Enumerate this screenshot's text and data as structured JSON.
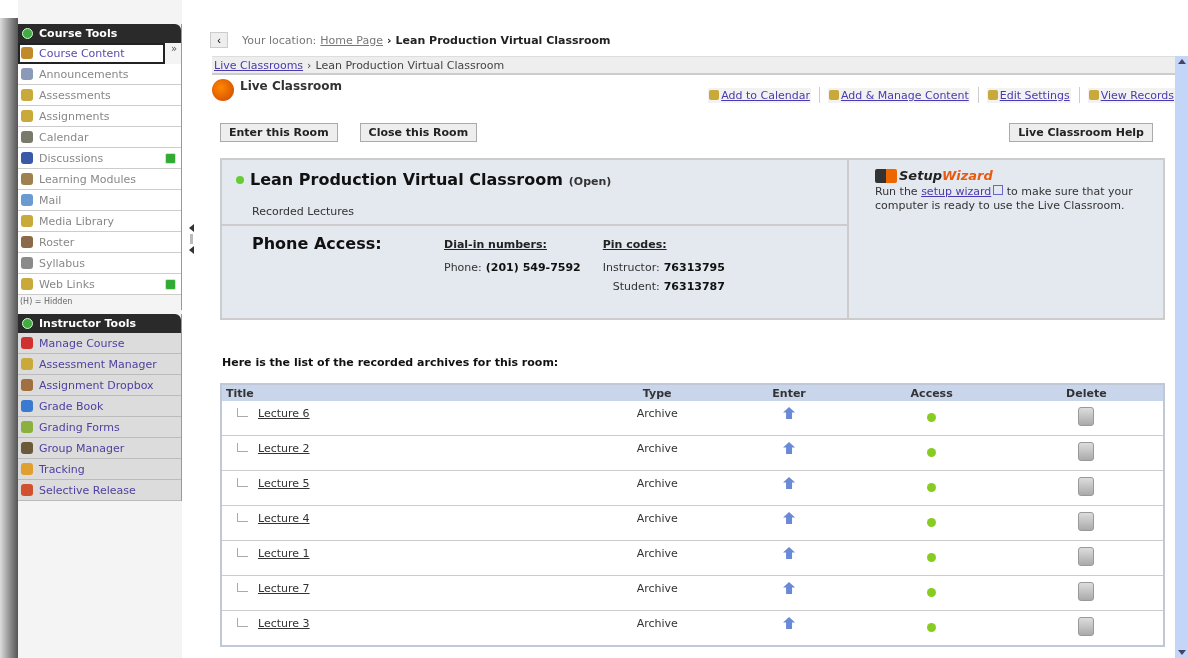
{
  "sidebar": {
    "course_tools": {
      "title": "Course Tools",
      "items": [
        {
          "label": "Course Content",
          "selected": true,
          "badge": false,
          "color": "#c08a2a"
        },
        {
          "label": "Announcements",
          "selected": false,
          "badge": false,
          "color": "#8a9ab8"
        },
        {
          "label": "Assessments",
          "selected": false,
          "badge": false,
          "color": "#c9a93a"
        },
        {
          "label": "Assignments",
          "selected": false,
          "badge": false,
          "color": "#c9a93a"
        },
        {
          "label": "Calendar",
          "selected": false,
          "badge": false,
          "color": "#7a7a6a"
        },
        {
          "label": "Discussions",
          "selected": false,
          "badge": true,
          "color": "#3a5aa8"
        },
        {
          "label": "Learning Modules",
          "selected": false,
          "badge": false,
          "color": "#a08050"
        },
        {
          "label": "Mail",
          "selected": false,
          "badge": false,
          "color": "#6a9ad0"
        },
        {
          "label": "Media Library",
          "selected": false,
          "badge": false,
          "color": "#c9a93a"
        },
        {
          "label": "Roster",
          "selected": false,
          "badge": false,
          "color": "#8a6a4a"
        },
        {
          "label": "Syllabus",
          "selected": false,
          "badge": false,
          "color": "#8a8a8a"
        },
        {
          "label": "Web Links",
          "selected": false,
          "badge": true,
          "color": "#c9a93a"
        }
      ],
      "collapse": "»",
      "legend": "(H) = Hidden"
    },
    "instructor_tools": {
      "title": "Instructor Tools",
      "items": [
        {
          "label": "Manage Course",
          "color": "#d03030"
        },
        {
          "label": "Assessment Manager",
          "color": "#c9a93a"
        },
        {
          "label": "Assignment Dropbox",
          "color": "#a07040"
        },
        {
          "label": "Grade Book",
          "color": "#3a7ad0"
        },
        {
          "label": "Grading Forms",
          "color": "#8ab040"
        },
        {
          "label": "Group Manager",
          "color": "#6a5a3a"
        },
        {
          "label": "Tracking",
          "color": "#e0a030"
        },
        {
          "label": "Selective Release",
          "color": "#d05030"
        }
      ]
    }
  },
  "location": {
    "back": "‹",
    "prefix": "Your location:",
    "home": "Home Page",
    "separator": "›",
    "current": "Lean Production Virtual Classroom"
  },
  "breadcrumb": {
    "link": "Live Classrooms",
    "separator": "›",
    "current": "Lean Production Virtual Classroom"
  },
  "header": {
    "title": "Live Classroom",
    "actions": [
      "Add to Calendar",
      "Add & Manage Content",
      "Edit Settings",
      "View Records"
    ]
  },
  "buttons": [
    "Enter this Room",
    "Close this Room"
  ],
  "help_button": "Live Classroom Help",
  "room": {
    "name": "Lean Production Virtual Classroom",
    "status": "(Open)",
    "subtitle": "Recorded Lectures",
    "phone_title": "Phone Access:",
    "dial_heading": "Dial-in numbers:",
    "pin_heading": "Pin codes:",
    "phone_label": "Phone:",
    "phone": "(201) 549-7592",
    "pins": [
      {
        "label": "Instructor:",
        "value": "76313795"
      },
      {
        "label": "Student:",
        "value": "76313787"
      }
    ]
  },
  "wizard": {
    "title_a": "Setup",
    "title_b": "Wizard",
    "text_before": "Run the",
    "link": "setup wizard",
    "text_after": "to make sure that your computer is ready to use the Live Classroom."
  },
  "archives_intro": "Here is the list of the recorded archives for this room:",
  "table": {
    "columns": [
      "Title",
      "Type",
      "Enter",
      "Access",
      "Delete"
    ],
    "rows": [
      {
        "title": "Lecture 6",
        "type": "Archive"
      },
      {
        "title": "Lecture 2",
        "type": "Archive"
      },
      {
        "title": "Lecture 5",
        "type": "Archive"
      },
      {
        "title": "Lecture 4",
        "type": "Archive"
      },
      {
        "title": "Lecture 1",
        "type": "Archive"
      },
      {
        "title": "Lecture 7",
        "type": "Archive"
      },
      {
        "title": "Lecture 3",
        "type": "Archive"
      }
    ]
  }
}
